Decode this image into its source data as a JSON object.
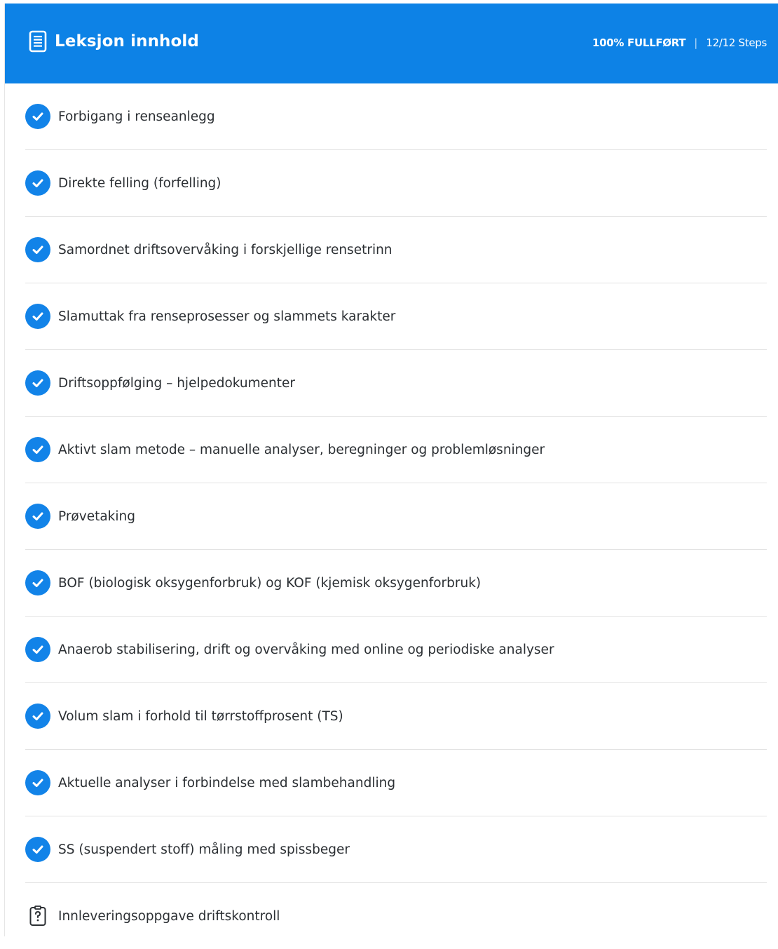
{
  "header": {
    "title": "Leksjon innhold",
    "progress_label": "100% FULLFØRT",
    "separator": "|",
    "steps_label": "12/12 Steps",
    "progress_fraction": 1.0,
    "accent_color": "#0d82e6"
  },
  "lessons": [
    {
      "label": "Forbigang i renseanlegg",
      "completed": true,
      "icon": "check-circle-icon"
    },
    {
      "label": "Direkte felling (forfelling)",
      "completed": true,
      "icon": "check-circle-icon"
    },
    {
      "label": "Samordnet driftsovervåking i forskjellige rensetrinn",
      "completed": true,
      "icon": "check-circle-icon"
    },
    {
      "label": "Slamuttak fra renseprosesser og slammets karakter",
      "completed": true,
      "icon": "check-circle-icon"
    },
    {
      "label": "Driftsoppfølging – hjelpedokumenter",
      "completed": true,
      "icon": "check-circle-icon"
    },
    {
      "label": "Aktivt slam metode – manuelle analyser, beregninger og problemløsninger",
      "completed": true,
      "icon": "check-circle-icon"
    },
    {
      "label": "Prøvetaking",
      "completed": true,
      "icon": "check-circle-icon"
    },
    {
      "label": "BOF (biologisk oksygenforbruk) og KOF (kjemisk oksygenforbruk)",
      "completed": true,
      "icon": "check-circle-icon"
    },
    {
      "label": "Anaerob stabilisering, drift og overvåking med online og periodiske analyser",
      "completed": true,
      "icon": "check-circle-icon"
    },
    {
      "label": "Volum slam i forhold til tørrstoffprosent (TS)",
      "completed": true,
      "icon": "check-circle-icon"
    },
    {
      "label": "Aktuelle analyser i forbindelse med slambehandling",
      "completed": true,
      "icon": "check-circle-icon"
    },
    {
      "label": "SS (suspendert stoff) måling med spissbeger",
      "completed": true,
      "icon": "check-circle-icon"
    },
    {
      "label": "Innleveringsoppgave driftskontroll",
      "completed": false,
      "icon": "quiz-icon"
    }
  ]
}
